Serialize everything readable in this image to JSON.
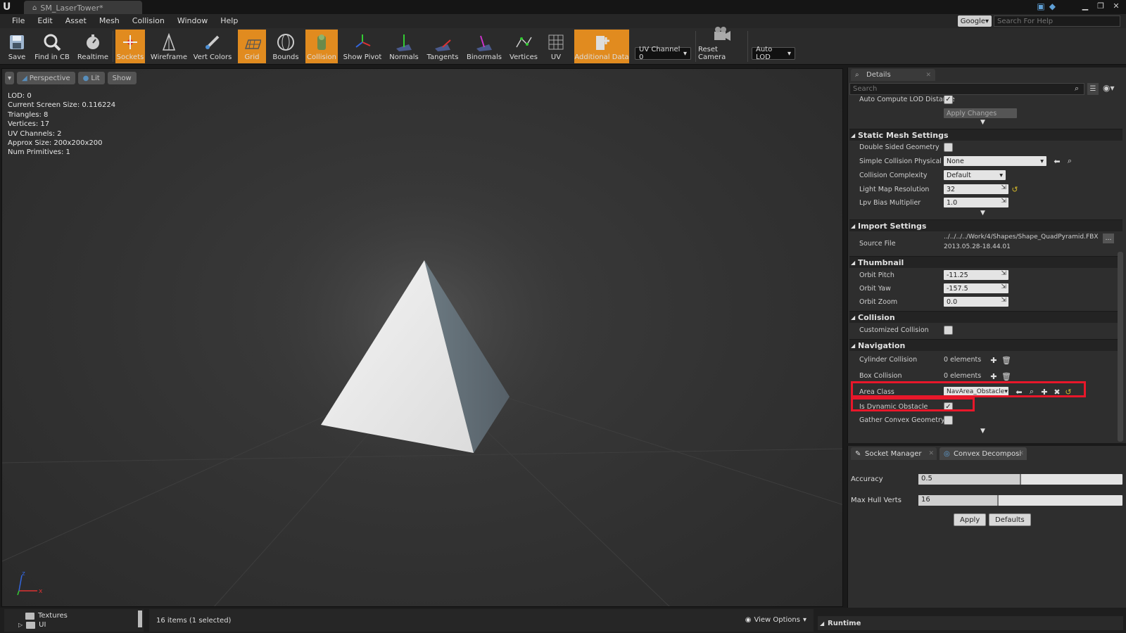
{
  "window": {
    "tab_title": "SM_LaserTower*"
  },
  "menu": {
    "items": [
      "File",
      "Edit",
      "Asset",
      "Mesh",
      "Collision",
      "Window",
      "Help"
    ],
    "search_provider": "Google",
    "search_placeholder": "Search For Help"
  },
  "toolbar": {
    "buttons": [
      {
        "label": "Save",
        "active": false
      },
      {
        "label": "Find in CB",
        "active": false
      },
      {
        "label": "Realtime",
        "active": false
      },
      {
        "label": "Sockets",
        "active": true
      },
      {
        "label": "Wireframe",
        "active": false
      },
      {
        "label": "Vert Colors",
        "active": false
      },
      {
        "label": "Grid",
        "active": true
      },
      {
        "label": "Bounds",
        "active": false
      },
      {
        "label": "Collision",
        "active": true
      },
      {
        "label": "Show Pivot",
        "active": false
      },
      {
        "label": "Normals",
        "active": false
      },
      {
        "label": "Tangents",
        "active": false
      },
      {
        "label": "Binormals",
        "active": false
      },
      {
        "label": "Vertices",
        "active": false
      },
      {
        "label": "UV",
        "active": false
      },
      {
        "label": "Additional Data",
        "active": true
      }
    ],
    "uv_channel": "UV Channel 0",
    "reset_camera": "Reset Camera",
    "auto_lod": "Auto LOD",
    "accent_color": "#e18b1f"
  },
  "viewport": {
    "perspective_label": "Perspective",
    "lit_label": "Lit",
    "show_label": "Show",
    "stats": [
      "LOD:  0",
      "Current Screen Size:  0.116224",
      "Triangles:  8",
      "Vertices:  17",
      "UV Channels:  2",
      "Approx Size: 200x200x200",
      "Num Primitives:  1"
    ]
  },
  "details": {
    "tab_label": "Details",
    "search_placeholder": "Search",
    "lod": {
      "auto_compute_label": "Auto Compute LOD Distance",
      "auto_compute_checked": true,
      "apply_changes_label": "Apply Changes"
    },
    "static_mesh_settings": {
      "title": "Static Mesh Settings",
      "double_sided_label": "Double Sided Geometry",
      "double_sided_checked": false,
      "simple_collision_label": "Simple Collision Physical M",
      "simple_collision_value": "None",
      "collision_complexity_label": "Collision Complexity",
      "collision_complexity_value": "Default",
      "light_map_label": "Light Map Resolution",
      "light_map_value": "32",
      "lpv_label": "Lpv Bias Multiplier",
      "lpv_value": "1.0"
    },
    "import_settings": {
      "title": "Import Settings",
      "source_file_label": "Source File",
      "source_file_path": "../../../../Work/4/Shapes/Shape_QuadPyramid.FBX",
      "source_file_date": "2013.05.28-18.44.01"
    },
    "thumbnail": {
      "title": "Thumbnail",
      "orbit_pitch_label": "Orbit Pitch",
      "orbit_pitch_value": "-11.25",
      "orbit_yaw_label": "Orbit Yaw",
      "orbit_yaw_value": "-157.5",
      "orbit_zoom_label": "Orbit Zoom",
      "orbit_zoom_value": "0.0"
    },
    "collision": {
      "title": "Collision",
      "customized_label": "Customized Collision",
      "customized_checked": false
    },
    "navigation": {
      "title": "Navigation",
      "cylinder_label": "Cylinder Collision",
      "cylinder_value": "0 elements",
      "box_label": "Box Collision",
      "box_value": "0 elements",
      "area_class_label": "Area Class",
      "area_class_value": "NavArea_Obstacle",
      "dynamic_obstacle_label": "Is Dynamic Obstacle",
      "dynamic_obstacle_checked": true,
      "gather_convex_label": "Gather Convex Geometry",
      "gather_convex_checked": false
    },
    "highlight_color": "#e8172a"
  },
  "convex": {
    "tab_socket": "Socket Manager",
    "tab_convex": "Convex Decomposi",
    "accuracy_label": "Accuracy",
    "accuracy_value": "0.5",
    "accuracy_fraction": 0.5,
    "max_hull_label": "Max Hull Verts",
    "max_hull_value": "16",
    "max_hull_fraction": 0.39,
    "apply_label": "Apply",
    "defaults_label": "Defaults"
  },
  "content_browser": {
    "folders": [
      "Textures",
      "UI"
    ],
    "items_status": "16 items (1 selected)",
    "view_options": "View Options",
    "runtime_label": "Runtime"
  }
}
